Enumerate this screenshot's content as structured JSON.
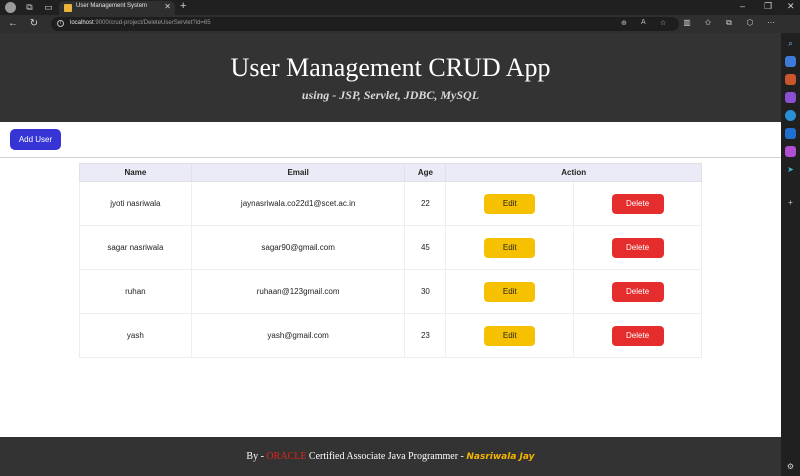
{
  "browser": {
    "tab_title": "User Management System",
    "url_host": "localhost",
    "url_path": ":9000/crud-project/DeleteUserServlet?id=65"
  },
  "header": {
    "title": "User Management CRUD App",
    "subtitle": "using - JSP, Servlet, JDBC, MySQL"
  },
  "actions": {
    "add_user_label": "Add User"
  },
  "table": {
    "columns": [
      "Name",
      "Email",
      "Age",
      "Action"
    ],
    "rows": [
      {
        "name": "jyoti nasriwala",
        "email": "jaynasriwala.co22d1@scet.ac.in",
        "age": "22",
        "edit": "Edit",
        "delete": "Delete"
      },
      {
        "name": "sagar nasriwala",
        "email": "sagar90@gmail.com",
        "age": "45",
        "edit": "Edit",
        "delete": "Delete"
      },
      {
        "name": "ruhan",
        "email": "ruhaan@123gmail.com",
        "age": "30",
        "edit": "Edit",
        "delete": "Delete"
      },
      {
        "name": "yash",
        "email": "yash@gmail.com",
        "age": "23",
        "edit": "Edit",
        "delete": "Delete"
      }
    ]
  },
  "footer": {
    "prefix": "By -",
    "oracle": "ORACLE",
    "middle": "Certified Associate Java Programmer -",
    "author": "Nasriwala Jay"
  },
  "colors": {
    "header_bg": "#333333",
    "add_button": "#3634d4",
    "edit_button": "#f6c100",
    "delete_button": "#e52d2d",
    "oracle_red": "#e0231b",
    "author_gold": "#f6b400"
  }
}
